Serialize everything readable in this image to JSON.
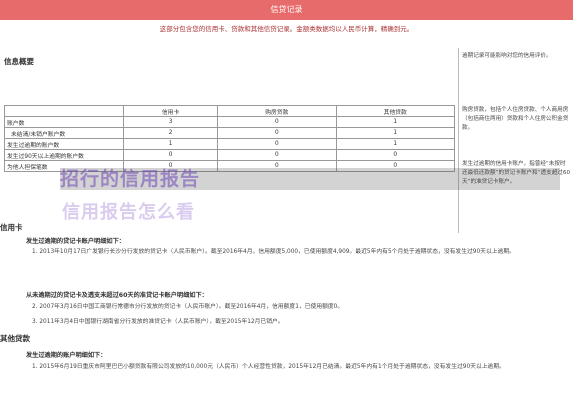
{
  "header": {
    "title": "信贷记录"
  },
  "subtitle": "这部分包含您的信用卡、贷款和其他信贷记录。金额类数据均以人民币计算，精确到元。",
  "overview": {
    "title": "信息概要",
    "columns": [
      "",
      "信用卡",
      "购房贷款",
      "其他贷款"
    ],
    "rows": [
      {
        "label": "账户数",
        "values": [
          "3",
          "0",
          "1"
        ]
      },
      {
        "label": "未结清/未销户账户数",
        "values": [
          "2",
          "0",
          "1"
        ]
      },
      {
        "label": "发生过逾期的账户数",
        "values": [
          "1",
          "0",
          "1"
        ]
      },
      {
        "label": "发生过90天以上逾期的账户数",
        "values": [
          "0",
          "0",
          "0"
        ]
      },
      {
        "label": "为他人担保笔数",
        "values": [
          "0",
          "0",
          "0"
        ]
      }
    ]
  },
  "right_panel": {
    "note1": "逾期记录可能影响对您的信用评价。",
    "note2": "购房贷款，包括个人住房贷款、个人商用房（包括商住两用）贷款和个人住房公积金贷款。",
    "note3": "发生过逾期的信用卡账户，指曾经“未按时还最低还款额”的贷记卡账户和“透支超过60天”的准贷记卡账户。"
  },
  "overlay": {
    "line1": "招行的信用报告",
    "line2": "信用报告怎么看"
  },
  "credit": {
    "title": "信用卡",
    "sub1": "发生过逾期的贷记卡账户明细如下：",
    "item1": "1. 2013年10月17日广发银行长沙分行发放的贷记卡（人民币账户）。截至2016年4月，信用额度5,000，已使用额度4,909。最近5年内有5个月处于逾期状态，没有发生过90天以上逾期。",
    "sub2": "从未逾期过的贷记卡及透支未超过60天的准贷记卡账户明细如下：",
    "item2": "2. 2007年3月16日中国工商银行常德市分行发放的贷记卡（人民币账户）。截至2016年4月，信用额度1，已使用额度0。",
    "item3": "3. 2011年3月4日中国银行湖南省分行发放的准贷记卡（人民币账户），截至2015年12月已销户。"
  },
  "other": {
    "title": "其他贷款",
    "sub1": "发生过逾期的账户明细如下：",
    "item1": "1. 2015年6月19日重庆市阿里巴巴小额贷款有限公司发放的10,000元（人民币）个人经营性贷款，2015年12月已结清。最近5年内有1个月处于逾期状态，没有发生过90天以上逾期。"
  }
}
